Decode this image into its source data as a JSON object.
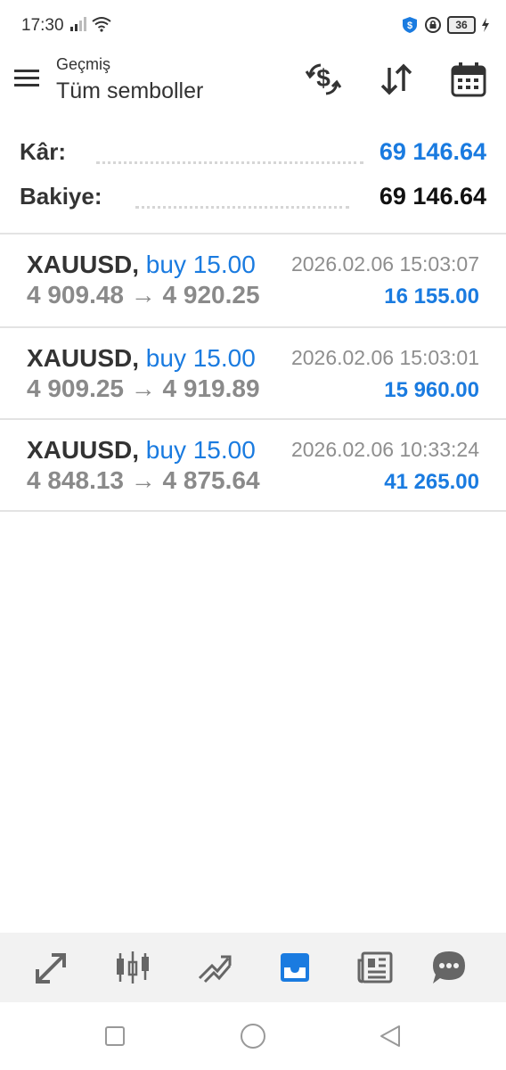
{
  "status_bar": {
    "time": "17:30",
    "battery_level": "36",
    "icons": [
      "signal-icon",
      "wifi-icon",
      "shield-icon",
      "vpn-lock-icon",
      "battery-icon",
      "charging-icon"
    ]
  },
  "header": {
    "subtitle": "Geçmiş",
    "title": "Tüm semboller",
    "actions": [
      "currency-exchange-icon",
      "sort-icon",
      "calendar-icon"
    ]
  },
  "summary": {
    "profit_label": "Kâr:",
    "profit_value": "69 146.64",
    "balance_label": "Bakiye:",
    "balance_value": "69 146.64"
  },
  "deals": [
    {
      "symbol": "XAUUSD,",
      "type": "buy 15.00",
      "time": "2026.02.06 15:03:07",
      "prices": "4 909.48 → 4 920.25",
      "profit": "16 155.00"
    },
    {
      "symbol": "XAUUSD,",
      "type": "buy 15.00",
      "time": "2026.02.06 15:03:01",
      "prices": "4 909.25 → 4 919.89",
      "profit": "15 960.00"
    },
    {
      "symbol": "XAUUSD,",
      "type": "buy 15.00",
      "time": "2026.02.06 10:33:24",
      "prices": "4 848.13 → 4 875.64",
      "profit": "41 265.00"
    }
  ],
  "bottom_nav": {
    "items": [
      "quotes-icon",
      "chart-icon",
      "trade-icon",
      "history-icon",
      "news-icon",
      "chat-icon"
    ],
    "active": "history-icon"
  },
  "colors": {
    "accent": "#1a7be0",
    "text": "#333333",
    "muted": "#8a8a8a",
    "nav_bg": "#f2f2f2",
    "divider": "#e3e3e3"
  }
}
